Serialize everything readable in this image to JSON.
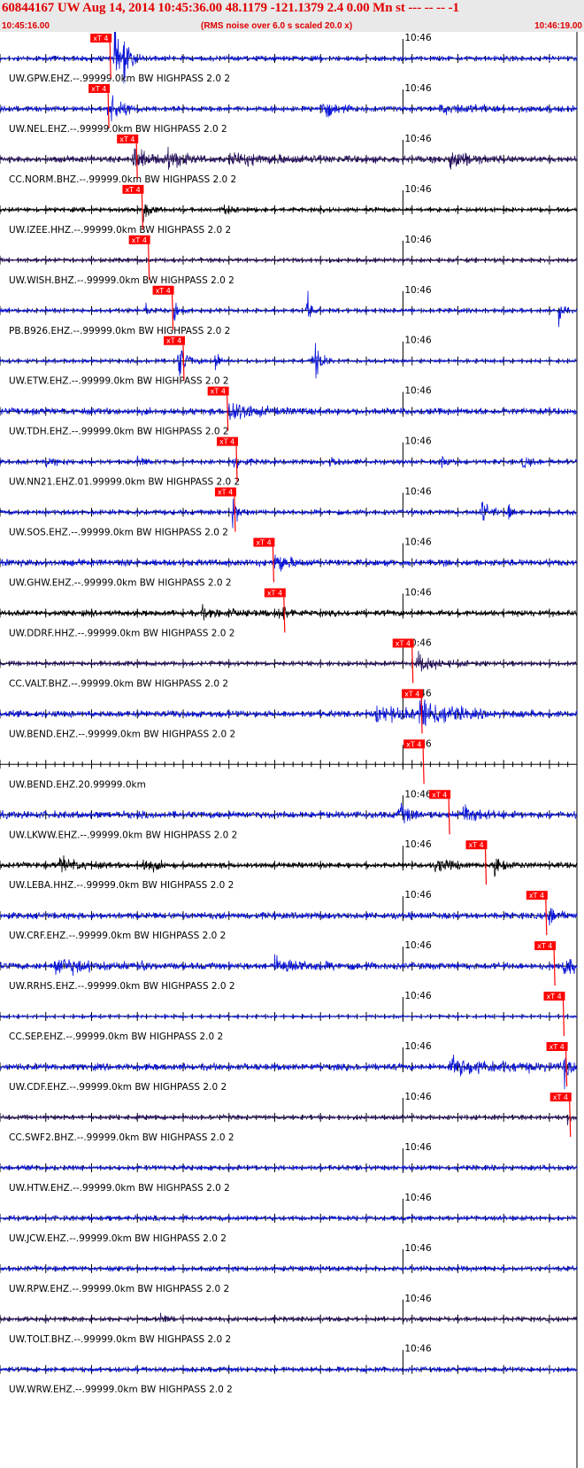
{
  "header": {
    "title": "60844167 UW Aug 14, 2014 10:45:36.00   48.1179 -121.1379  2.4 0.00 Mn st --- -- --   -1",
    "start_time": "10:45:16.00",
    "rms_note": "(RMS noise over 6.0 s scaled 20.0 x)",
    "end_time": "10:46:19.00"
  },
  "colors": {
    "header_bg": "#e9e9e9",
    "title_red": "#e00000",
    "pick_red": "#ff0000",
    "trace_blue": "#0a14d8",
    "trace_navy": "#2a1460",
    "trace_black": "#000000",
    "axis": "#000000"
  },
  "chart_data": {
    "type": "seismogram",
    "x_range_s": [
      0,
      63
    ],
    "time_mark": {
      "label": "10:46",
      "t": 44
    },
    "pick_label": "xT 4",
    "traces": [
      {
        "label": "UW.GPW.EHZ.--.99999.0km BW  HIGHPASS  2.0  2",
        "color": "blue",
        "pick": 12.0,
        "noise": 0.22,
        "bursts": [
          [
            12.5,
            2.2,
            1.0
          ],
          [
            13.5,
            1.2,
            0.5
          ]
        ]
      },
      {
        "label": "UW.NEL.EHZ.--.99999.0km BW  HIGHPASS  2.0  2",
        "color": "blue",
        "pick": 11.8,
        "noise": 0.22,
        "bursts": [
          [
            11.8,
            1.6,
            1.2
          ],
          [
            35.0,
            0.9,
            1.5
          ],
          [
            48,
            0.3,
            8
          ]
        ]
      },
      {
        "label": "CC.NORM.BHZ.--.99999.0km BW  HIGHPASS  2.0  2",
        "color": "navy",
        "pick": 14.9,
        "noise": 0.28,
        "bursts": [
          [
            14.5,
            1.1,
            1.5
          ],
          [
            18.0,
            1.2,
            1.5
          ],
          [
            49.0,
            1.0,
            2.0
          ],
          [
            25,
            0.4,
            8
          ]
        ]
      },
      {
        "label": "UW.IZEE.HHZ.--.99999.0km BW  HIGHPASS  2.0  2",
        "color": "black",
        "pick": 15.5,
        "noise": 0.18,
        "bursts": [
          [
            15.6,
            1.5,
            0.6
          ],
          [
            24.5,
            0.6,
            0.6
          ]
        ]
      },
      {
        "label": "UW.WISH.BHZ.--.99999.0km BW  HIGHPASS  2.0  2",
        "color": "navy",
        "pick": 16.2,
        "noise": 0.18,
        "bursts": []
      },
      {
        "label": "PB.B926.EHZ.--.99999.0km BW  HIGHPASS  2.0  2",
        "color": "blue",
        "pick": 18.8,
        "noise": 0.18,
        "bursts": [
          [
            18.9,
            1.5,
            0.4
          ],
          [
            15.8,
            1.0,
            0.3
          ],
          [
            33.5,
            1.8,
            0.4
          ],
          [
            61.0,
            2.0,
            0.3
          ]
        ]
      },
      {
        "label": "UW.ETW.EHZ.--.99999.0km BW  HIGHPASS  2.0  2",
        "color": "blue",
        "pick": 20.0,
        "noise": 0.16,
        "bursts": [
          [
            19.5,
            2.2,
            0.7
          ],
          [
            23.5,
            1.6,
            0.3
          ],
          [
            34.2,
            2.6,
            0.6
          ]
        ]
      },
      {
        "label": "UW.TDH.EHZ.--.99999.0km BW  HIGHPASS  2.0  2",
        "color": "blue",
        "pick": 24.8,
        "noise": 0.3,
        "bursts": [
          [
            25.0,
            1.1,
            2.0
          ]
        ]
      },
      {
        "label": "UW.NN21.EHZ.01.99999.0km BW  HIGHPASS  2.0  2",
        "color": "blue",
        "pick": 25.8,
        "noise": 0.2,
        "bursts": [
          [
            5,
            0.4,
            1
          ],
          [
            15,
            0.4,
            1
          ],
          [
            25.5,
            0.6,
            1
          ],
          [
            36,
            0.5,
            1
          ],
          [
            48,
            0.5,
            1
          ],
          [
            57,
            0.5,
            1
          ]
        ]
      },
      {
        "label": "UW.SOS.EHZ.--.99999.0km BW  HIGHPASS  2.0  2",
        "color": "blue",
        "pick": 25.6,
        "noise": 0.22,
        "bursts": [
          [
            25.4,
            1.3,
            0.6
          ],
          [
            52.5,
            1.2,
            0.8
          ],
          [
            55.5,
            0.9,
            0.5
          ]
        ]
      },
      {
        "label": "UW.GHW.EHZ.--.99999.0km BW  HIGHPASS  2.0  2",
        "color": "blue",
        "pick": 29.8,
        "noise": 0.3,
        "bursts": [
          [
            30.0,
            1.1,
            1.2
          ]
        ]
      },
      {
        "label": "UW.DDRF.HHZ.--.99999.0km BW  HIGHPASS  2.0  2",
        "color": "black",
        "pick": 31.0,
        "noise": 0.26,
        "bursts": [
          [
            30.5,
            0.9,
            0.8
          ],
          [
            22,
            0.4,
            3
          ]
        ]
      },
      {
        "label": "CC.VALT.BHZ.--.99999.0km BW  HIGHPASS  2.0  2",
        "color": "navy",
        "pick": 45.0,
        "noise": 0.2,
        "bursts": [
          [
            45.5,
            0.9,
            2.0
          ]
        ]
      },
      {
        "label": "UW.BEND.EHZ.--.99999.0km BW  HIGHPASS  2.0  2",
        "color": "blue",
        "pick": 46.0,
        "noise": 0.3,
        "bursts": [
          [
            45.8,
            1.6,
            2.5
          ],
          [
            41,
            0.6,
            4
          ]
        ]
      },
      {
        "label": "UW.BEND.EHZ.20.99999.0km",
        "color": "none",
        "pick": 46.2,
        "noise": 0,
        "bursts": []
      },
      {
        "label": "UW.LKWW.EHZ.--.99999.0km BW  HIGHPASS  2.0  2",
        "color": "blue",
        "pick": 49.0,
        "noise": 0.32,
        "bursts": [
          [
            43.5,
            0.9,
            1.2
          ],
          [
            50.5,
            1.1,
            1.3
          ]
        ]
      },
      {
        "label": "UW.LEBA.HHZ.--.99999.0km BW  HIGHPASS  2.0  2",
        "color": "black",
        "pick": 53.0,
        "noise": 0.24,
        "bursts": [
          [
            6.5,
            0.7,
            2.0
          ],
          [
            15.5,
            0.6,
            1.5
          ],
          [
            47.5,
            0.6,
            1.5
          ],
          [
            54.0,
            1.2,
            1.0
          ]
        ]
      },
      {
        "label": "UW.CRF.EHZ.--.99999.0km BW  HIGHPASS  2.0  2",
        "color": "blue",
        "pick": 59.6,
        "noise": 0.3,
        "bursts": [
          [
            59.8,
            1.1,
            0.8
          ]
        ]
      },
      {
        "label": "UW.RRHS.EHZ.--.99999.0km BW  HIGHPASS  2.0  2",
        "color": "blue",
        "pick": 60.5,
        "noise": 0.3,
        "bursts": [
          [
            6,
            0.8,
            3
          ],
          [
            15.5,
            1.3,
            0.2
          ],
          [
            30,
            0.7,
            3
          ],
          [
            61.5,
            1.0,
            1.0
          ]
        ]
      },
      {
        "label": "CC.SEP.EHZ.--.99999.0km BW  HIGHPASS  2.0  2",
        "color": "blue",
        "pick": 61.5,
        "noise": 0.12,
        "bursts": []
      },
      {
        "label": "UW.CDF.EHZ.--.99999.0km BW  HIGHPASS  2.0  2",
        "color": "blue",
        "pick": 61.8,
        "noise": 0.3,
        "bursts": [
          [
            49,
            0.7,
            6
          ],
          [
            61.6,
            1.2,
            0.8
          ]
        ]
      },
      {
        "label": "CC.SWF2.BHZ.--.99999.0km BW  HIGHPASS  2.0  2",
        "color": "navy",
        "pick": 62.2,
        "noise": 0.2,
        "bursts": [
          [
            62,
            0.6,
            0.5
          ]
        ]
      },
      {
        "label": "UW.HTW.EHZ.--.99999.0km BW  HIGHPASS  2.0  2",
        "color": "blue",
        "pick": null,
        "noise": 0.22,
        "bursts": []
      },
      {
        "label": "UW.JCW.EHZ.--.99999.0km BW  HIGHPASS  2.0  2",
        "color": "blue",
        "pick": null,
        "noise": 0.22,
        "bursts": []
      },
      {
        "label": "UW.RPW.EHZ.--.99999.0km BW  HIGHPASS  2.0  2",
        "color": "blue",
        "pick": null,
        "noise": 0.22,
        "bursts": []
      },
      {
        "label": "UW.TOLT.BHZ.--.99999.0km BW  HIGHPASS  2.0  2",
        "color": "navy",
        "pick": null,
        "noise": 0.2,
        "bursts": [
          [
            17.5,
            0.4,
            1.0
          ]
        ]
      },
      {
        "label": "UW.WRW.EHZ.--.99999.0km BW  HIGHPASS  2.0  2",
        "color": "blue",
        "pick": null,
        "noise": 0.22,
        "bursts": []
      }
    ]
  }
}
